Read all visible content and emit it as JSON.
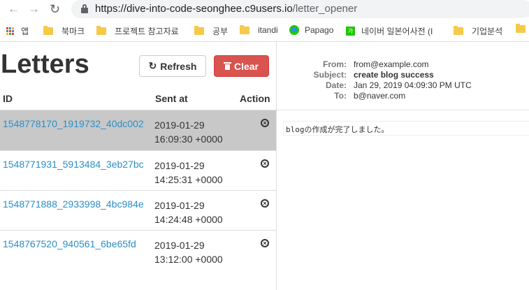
{
  "browser": {
    "url_host": "https://dive-into-code-seonghee.c9users.io",
    "url_path": "/letter_opener",
    "bookmarks": [
      "앱",
      "북마크",
      "프로젝트 참고자료",
      "공부",
      "itandi",
      "Papago",
      "네이버 일본어사전 (I",
      "기업분석"
    ]
  },
  "page": {
    "title": "Letters",
    "refresh_label": "Refresh",
    "clear_label": "Clear",
    "columns": {
      "id": "ID",
      "sent_at": "Sent at",
      "action": "Action"
    }
  },
  "letters": [
    {
      "id": "1548778170_1919732_40dc002",
      "date": "2019-01-29",
      "time": "16:09:30 +0000",
      "selected": true
    },
    {
      "id": "1548771931_5913484_3eb27bc",
      "date": "2019-01-29",
      "time": "14:25:31 +0000",
      "selected": false
    },
    {
      "id": "1548771888_2933998_4bc984e",
      "date": "2019-01-29",
      "time": "14:24:48 +0000",
      "selected": false
    },
    {
      "id": "1548767520_940561_6be65fd",
      "date": "2019-01-29",
      "time": "13:12:00 +0000",
      "selected": false
    }
  ],
  "message": {
    "labels": {
      "from": "From:",
      "subject": "Subject:",
      "date": "Date:",
      "to": "To:"
    },
    "from": "from@example.com",
    "subject": "create blog success",
    "date": "Jan 29, 2019 04:09:30 PM UTC",
    "to": "b@naver.com",
    "body": "blogの作成が完了しました。"
  },
  "colors": {
    "clear_button": "#d9534f",
    "link": "#2a8fc7",
    "selected_row": "#c8c8c8"
  }
}
